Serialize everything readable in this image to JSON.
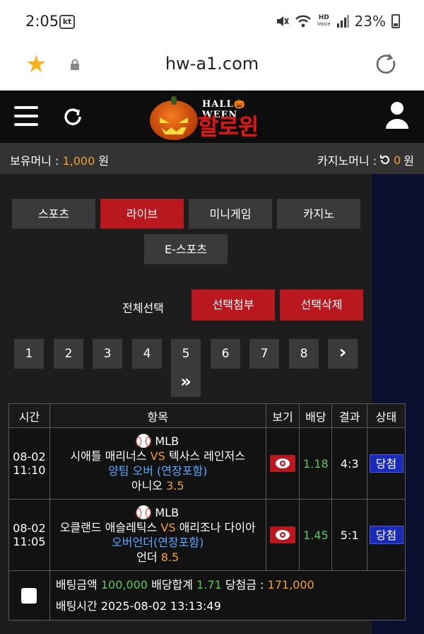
{
  "status_bar": {
    "time": "2:05",
    "carrier_badge": "kt",
    "hd_label": "HD",
    "voice_label": "Voice",
    "battery": "23%"
  },
  "browser": {
    "url": "hw-a1.com"
  },
  "header": {
    "logo_title": "HALL🎃WEEN",
    "logo_korean": "할로윈"
  },
  "money": {
    "holding_label": "보유머니 :",
    "holding_value": "1,000",
    "holding_unit": "원",
    "casino_label": "카지노머니 :",
    "casino_value": "0",
    "casino_unit": "원"
  },
  "categories": [
    {
      "label": "스포츠",
      "active": false
    },
    {
      "label": "라이브",
      "active": true
    },
    {
      "label": "미니게임",
      "active": false
    },
    {
      "label": "카지노",
      "active": false
    },
    {
      "label": "E-스포츠",
      "active": false
    }
  ],
  "actions": {
    "select_all": "전체선택",
    "attach_selected": "선택첨부",
    "delete_selected": "선택삭제"
  },
  "pagination": {
    "pages": [
      "1",
      "2",
      "3",
      "4",
      "5",
      "6",
      "7",
      "8"
    ],
    "next": "›",
    "last": "»"
  },
  "table": {
    "headers": [
      "시간",
      "항목",
      "보기",
      "배당",
      "결과",
      "상태"
    ],
    "rows": [
      {
        "date": "08-02",
        "time": "11:10",
        "league": "MLB",
        "home": "시애틀 매리너스",
        "vs": "VS",
        "away": "텍사스 레인저스",
        "pick": "양팀 오버 (연장포함)",
        "choice": "아니오",
        "choice_odds": "3.5",
        "odds": "1.18",
        "result": "4:3",
        "status": "당첨"
      },
      {
        "date": "08-02",
        "time": "11:05",
        "league": "MLB",
        "home": "오클랜드 애슬레틱스",
        "vs": "VS",
        "away": "애리조나 다이아",
        "pick": "오버언더(연장포함)",
        "choice": "언더",
        "choice_odds": "8.5",
        "odds": "1.45",
        "result": "5:1",
        "status": "당첨"
      }
    ],
    "summary": {
      "bet_amount_label": "배팅금액",
      "bet_amount": "100,000",
      "odds_total_label": "배당합계",
      "odds_total": "1.71",
      "win_amount_label": "당첨금 :",
      "win_amount": "171,000",
      "bet_time_label": "배팅시간",
      "bet_time": "2025-08-02 13:13:49"
    }
  }
}
